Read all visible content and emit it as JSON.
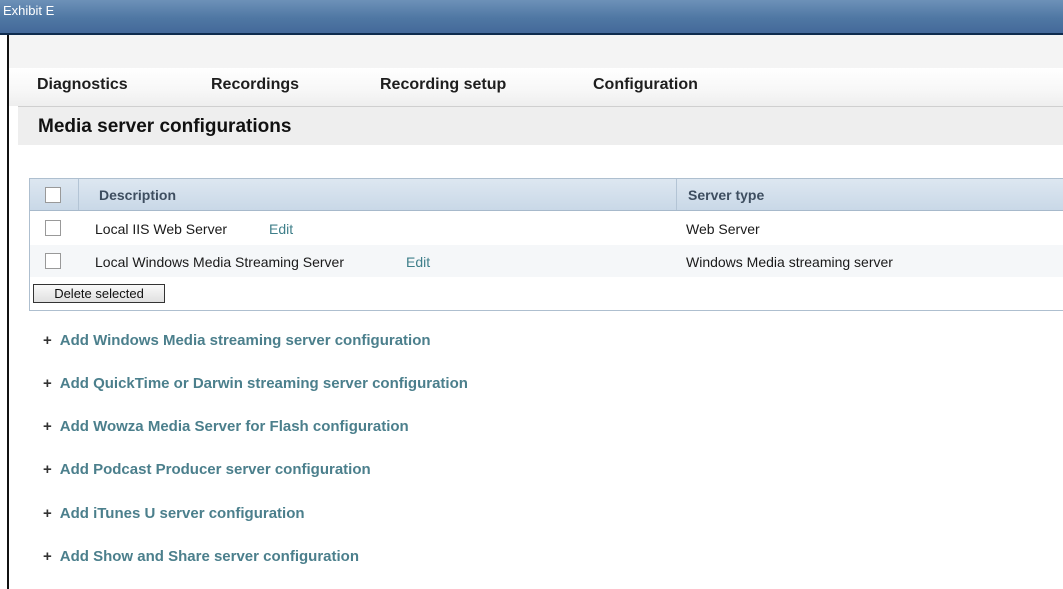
{
  "exhibit": {
    "title": "Exhibit E"
  },
  "nav": {
    "items": [
      "Diagnostics",
      "Recordings",
      "Recording setup",
      "Configuration"
    ]
  },
  "page": {
    "title": "Media server configurations"
  },
  "table": {
    "columns": [
      "Description",
      "Server type"
    ],
    "rows": [
      {
        "description": "Local IIS Web Server",
        "edit_label": "Edit",
        "server_type": "Web Server"
      },
      {
        "description": "Local Windows Media Streaming Server",
        "edit_label": "Edit",
        "server_type": "Windows Media streaming server"
      }
    ],
    "delete_label": "Delete selected"
  },
  "add_links": [
    "Add Windows Media streaming server configuration",
    "Add QuickTime or Darwin streaming server configuration",
    "Add Wowza Media Server for Flash configuration",
    "Add Podcast Producer server configuration",
    "Add iTunes U server configuration",
    "Add Show and Share server configuration"
  ],
  "icons": {
    "add": "plus-icon"
  },
  "colors": {
    "header_bar": "#4f77a3",
    "link": "#4b7f8c",
    "table_header": "#c9d8e7"
  }
}
